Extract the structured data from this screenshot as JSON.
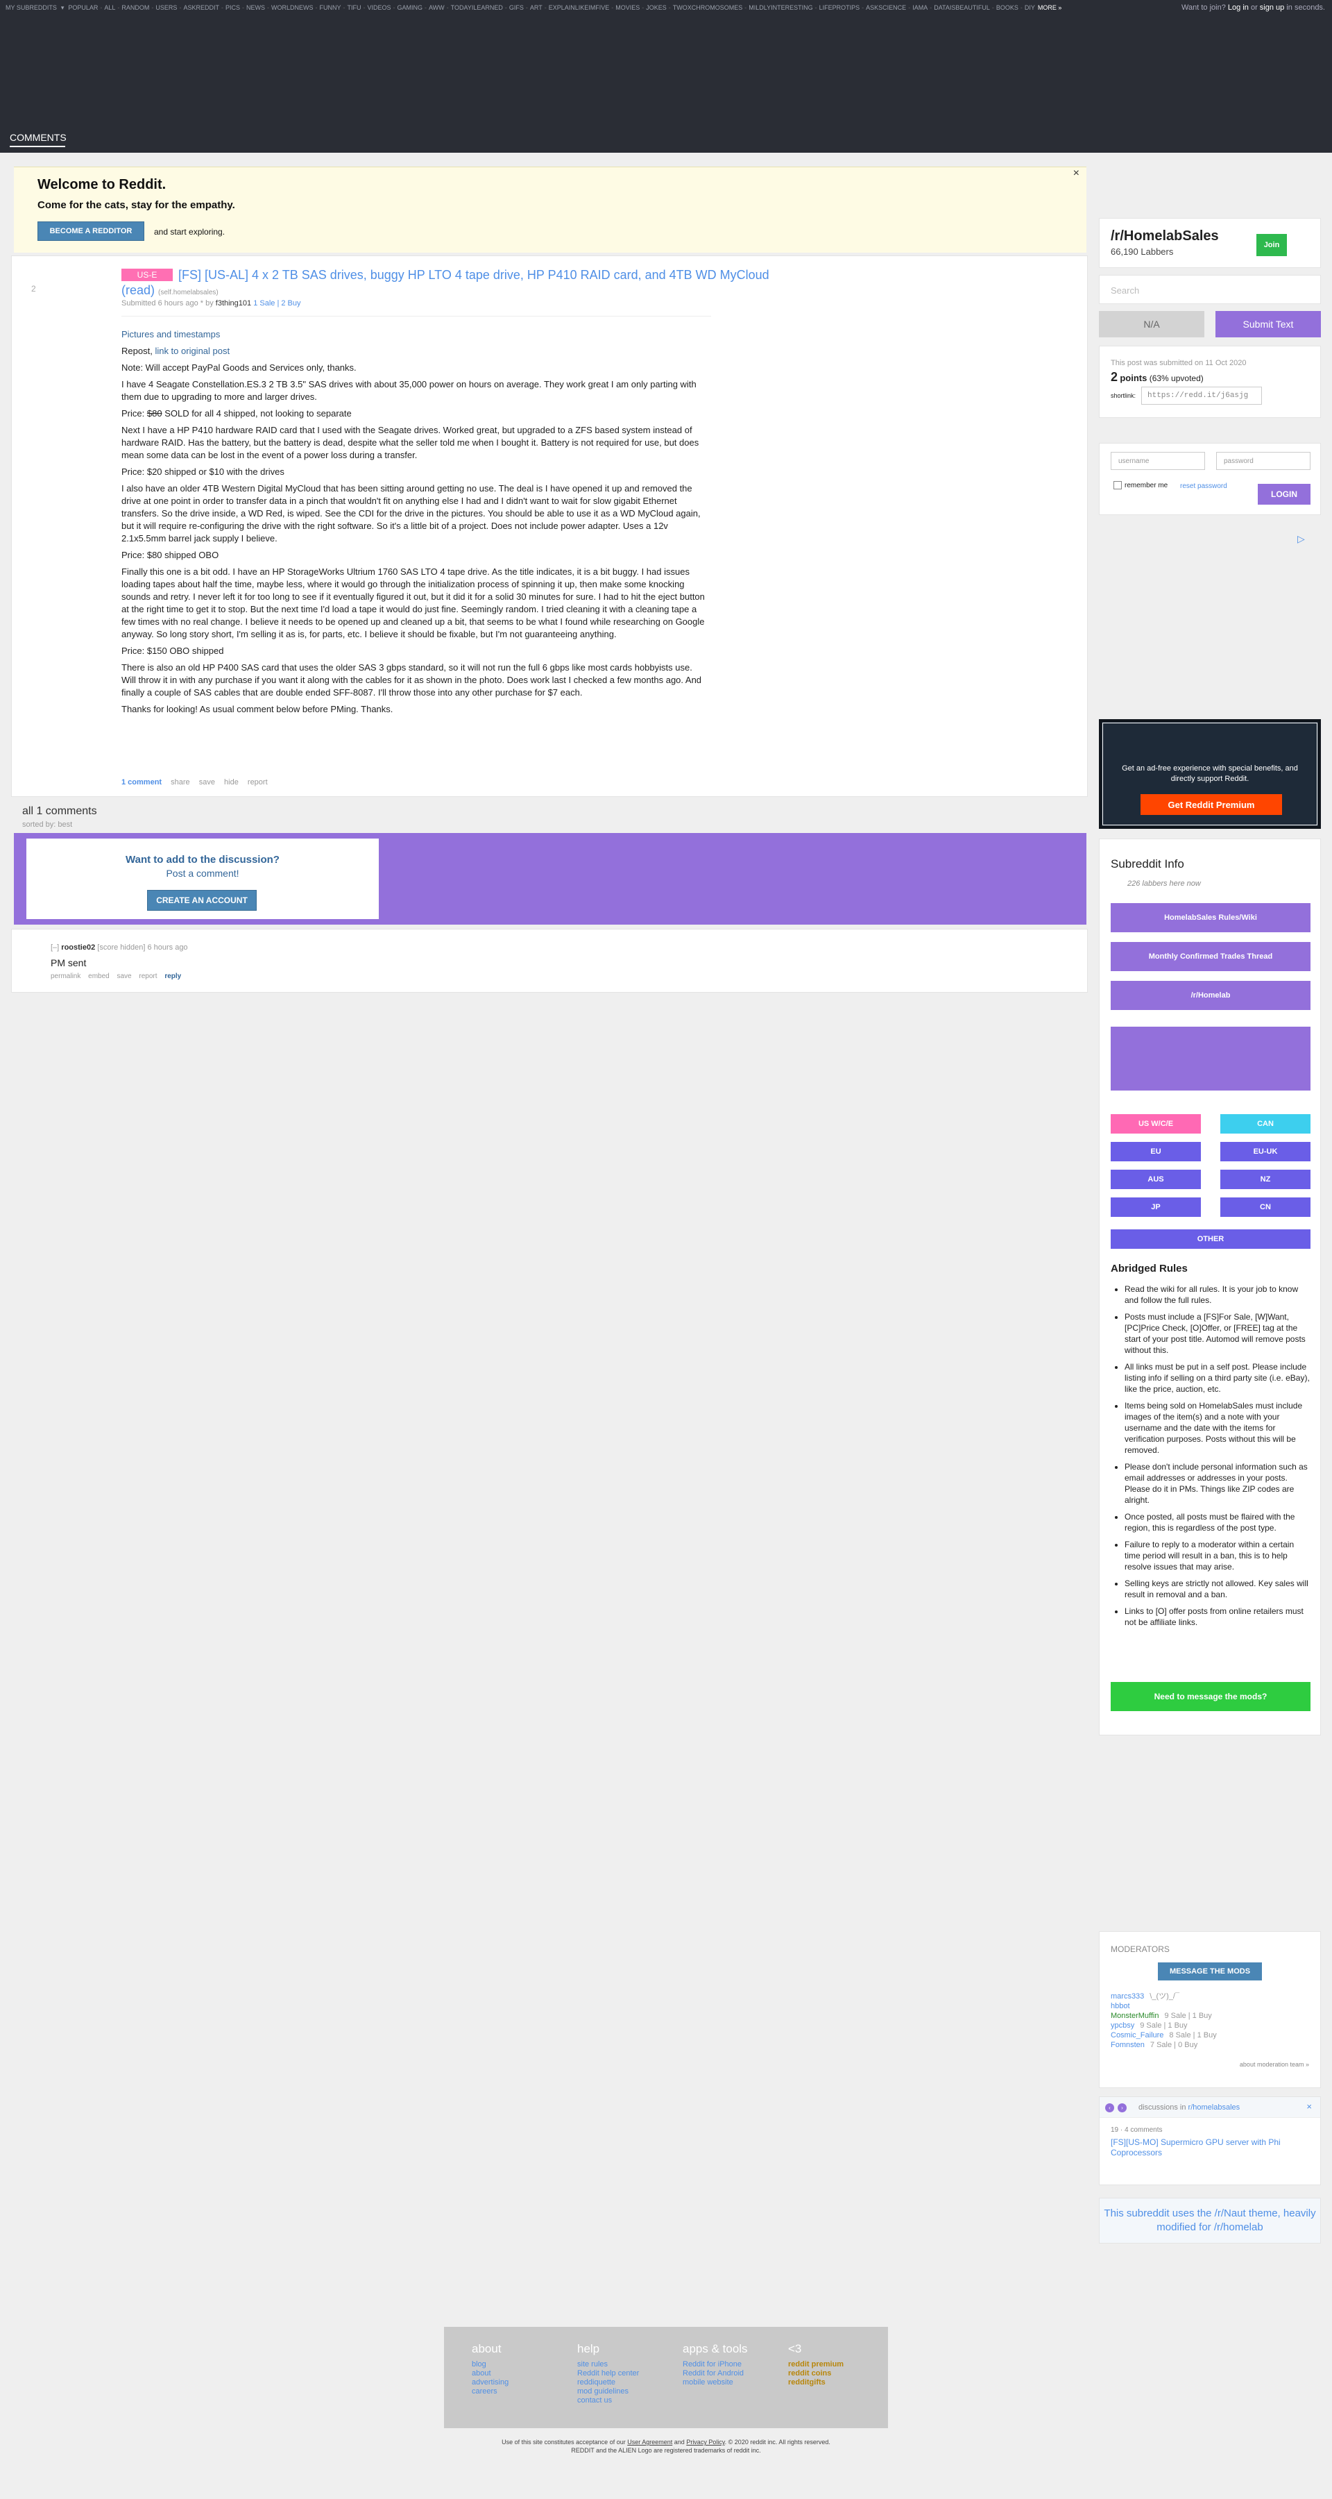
{
  "topbar": {
    "my_subreddits": "MY SUBREDDITS",
    "links": [
      "POPULAR",
      "ALL",
      "RANDOM",
      "USERS",
      "ASKREDDIT",
      "PICS",
      "NEWS",
      "WORLDNEWS",
      "FUNNY",
      "TIFU",
      "VIDEOS",
      "GAMING",
      "AWW",
      "TODAYILEARNED",
      "GIFS",
      "ART",
      "EXPLAINLIKEIMFIVE",
      "MOVIES",
      "JOKES",
      "TWOXCHROMOSOMES",
      "MILDLYINTERESTING",
      "LIFEPROTIPS",
      "ASKSCIENCE",
      "IAMA",
      "DATAISBEAUTIFUL",
      "BOOKS",
      "DIY"
    ],
    "more": "MORE »",
    "right_prefix": "Want to join?",
    "login": "Log in",
    "or": "or",
    "signup": "sign up",
    "right_suffix": "in seconds."
  },
  "header": {
    "tab": "COMMENTS"
  },
  "welcome": {
    "title": "Welcome to Reddit.",
    "subtitle": "Come for the cats, stay for the empathy.",
    "button": "BECOME A REDDITOR",
    "after": "and start exploring.",
    "close": "×"
  },
  "post": {
    "rank": "2",
    "flair": "US-E",
    "title": "[FS] [US-AL] 4 x 2 TB SAS drives, buggy HP LTO 4 tape drive, HP P410 RAID card, and 4TB WD MyCloud (read)",
    "domain": "(self.homelabsales)",
    "submitted": "Submitted 6 hours ago * by",
    "author": "f3thing101",
    "author_flair": "1 Sale | 2 Buy",
    "body": {
      "pictures": "Pictures and timestamps",
      "repost_prefix": "Repost,",
      "repost_link": "link to original post",
      "p_paypal": "Note: Will accept PayPal Goods and Services only, thanks.",
      "p_seagate": "I have 4 Seagate Constellation.ES.3 2 TB 3.5\" SAS drives with about 35,000 power on hours on average. They work great I am only parting with them due to upgrading to more and larger drives.",
      "price1_prefix": "Price:",
      "price1_strike": "$80",
      "price1_rest": "SOLD for all 4 shipped, not looking to separate",
      "p_raid": "Next I have a HP P410 hardware RAID card that I used with the Seagate drives. Worked great, but upgraded to a ZFS based system instead of hardware RAID. Has the battery, but the battery is dead, despite what the seller told me when I bought it. Battery is not required for use, but does mean some data can be lost in the event of a power loss during a transfer.",
      "price2": "Price: $20 shipped or $10 with the drives",
      "p_mycloud": "I also have an older 4TB Western Digital MyCloud that has been sitting around getting no use. The deal is I have opened it up and removed the drive at one point in order to transfer data in a pinch that wouldn't fit on anything else I had and I didn't want to wait for slow gigabit Ethernet transfers. So the drive inside, a WD Red, is wiped. See the CDI for the drive in the pictures. You should be able to use it as a WD MyCloud again, but it will require re-configuring the drive with the right software. So it's a little bit of a project. Does not include power adapter. Uses a 12v 2.1x5.5mm barrel jack supply I believe.",
      "price3": "Price: $80 shipped OBO",
      "p_lto": "Finally this one is a bit odd. I have an HP StorageWorks Ultrium 1760 SAS LTO 4 tape drive. As the title indicates, it is a bit buggy. I had issues loading tapes about half the time, maybe less, where it would go through the initialization process of spinning it up, then make some knocking sounds and retry. I never left it for too long to see if it eventually figured it out, but it did it for a solid 30 minutes for sure. I had to hit the eject button at the right time to get it to stop. But the next time I'd load a tape it would do just fine. Seemingly random. I tried cleaning it with a cleaning tape a few times with no real change. I believe it needs to be opened up and cleaned up a bit, that seems to be what I found while researching on Google anyway. So long story short, I'm selling it as is, for parts, etc. I believe it should be fixable, but I'm not guaranteeing anything.",
      "price4": "Price: $150 OBO shipped",
      "p_p400": "There is also an old HP P400 SAS card that uses the older SAS 3 gbps standard, so it will not run the full 6 gbps like most cards hobbyists use. Will throw it in with any purchase if you want it along with the cables for it as shown in the photo. Does work last I checked a few months ago. And finally a couple of SAS cables that are double ended SFF-8087. I'll throw those into any other purchase for $7 each.",
      "p_thanks": "Thanks for looking! As usual comment below before PMing. Thanks."
    },
    "actions": {
      "comments": "1 comment",
      "share": "share",
      "save": "save",
      "hide": "hide",
      "report": "report"
    }
  },
  "comments_area": {
    "heading": "all 1 comments",
    "sorted": "sorted by: best",
    "want": "Want to add to the discussion?",
    "post_comment": "Post a comment!",
    "create": "CREATE AN ACCOUNT",
    "comment": {
      "collapse": "[–]",
      "author": "roostie02",
      "score": "[score hidden]",
      "time": "6 hours ago",
      "text": "PM sent",
      "actions": [
        "permalink",
        "embed",
        "save",
        "report"
      ],
      "reply": "reply"
    }
  },
  "sidebar": {
    "sub_name": "/r/HomelabSales",
    "labbers": "66,190 Labbers",
    "join": "Join",
    "search_placeholder": "Search",
    "na": "N/A",
    "submit_text": "Submit Text",
    "submitted_on": "This post was submitted on 11 Oct 2020",
    "points": "2",
    "points_label": "points",
    "upvoted": "(63% upvoted)",
    "shortlink_label": "shortlink:",
    "shortlink": "https://redd.it/j6asjg",
    "username_ph": "username",
    "password_ph": "password",
    "remember": "remember me",
    "reset": "reset password",
    "login": "LOGIN",
    "adchoice": "▷",
    "premium_text": "Get an ad-free experience with special benefits, and directly support Reddit.",
    "premium_button": "Get Reddit Premium",
    "info_title": "Subreddit Info",
    "labbers_here": "226 labbers here now",
    "buttons": [
      "HomelabSales Rules/Wiki",
      "Monthly Confirmed Trades Thread",
      "/r/Homelab"
    ],
    "regions": [
      {
        "label": "US W/C/E",
        "color": "#ff69b4"
      },
      {
        "label": "CAN",
        "color": "#3dcfee"
      },
      {
        "label": "EU",
        "color": "#6a5ee7"
      },
      {
        "label": "EU-UK",
        "color": "#6a5ee7"
      },
      {
        "label": "AUS",
        "color": "#6a5ee7"
      },
      {
        "label": "NZ",
        "color": "#6a5ee7"
      },
      {
        "label": "JP",
        "color": "#6a5ee7"
      },
      {
        "label": "CN",
        "color": "#6a5ee7"
      },
      {
        "label": "OTHER",
        "color": "#6a5ee7"
      }
    ],
    "rules_title": "Abridged Rules",
    "rules": [
      "Read the wiki for all rules. It is your job to know and follow the full rules.",
      "Posts must include a [FS]For Sale, [W]Want, [PC]Price Check, [O]Offer, or [FREE] tag at the start of your post title. Automod will remove posts without this.",
      "All links must be put in a self post. Please include listing info if selling on a third party site (i.e. eBay), like the price, auction, etc.",
      "Items being sold on HomelabSales must include images of the item(s) and a note with your username and the date with the items for verification purposes. Posts without this will be removed.",
      "Please don't include personal information such as email addresses or addresses in your posts. Please do it in PMs. Things like ZIP codes are alright.",
      "Once posted, all posts must be flaired with the region, this is regardless of the post type.",
      "Failure to reply to a moderator within a certain time period will result in a ban, this is to help resolve issues that may arise.",
      "Selling keys are strictly not allowed. Key sales will result in removal and a ban.",
      "Links to [O] offer posts from online retailers must not be affiliate links."
    ],
    "modmsg_button": "Need to message the mods?",
    "moderators_title": "MODERATORS",
    "message_mods": "MESSAGE THE MODS",
    "mods": [
      {
        "name": "marcs333",
        "flair": "\\_(ツ)_/¯",
        "green": false
      },
      {
        "name": "hbbot",
        "flair": "",
        "green": false
      },
      {
        "name": "MonsterMuffin",
        "flair": "9 Sale | 1 Buy",
        "green": true
      },
      {
        "name": "ypcbsy",
        "flair": "9 Sale | 1 Buy",
        "green": false
      },
      {
        "name": "Cosmic_Failure",
        "flair": "8 Sale | 1 Buy",
        "green": false
      },
      {
        "name": "Fomnsten",
        "flair": "7 Sale | 0 Buy",
        "green": false
      }
    ],
    "mod_team": "about moderation team »",
    "discussions_prefix": "discussions in",
    "discussions_sub": "r/homelabsales",
    "discussion_meta": "19 · 4 comments",
    "discussion_link": "[FS][US-MO] Supermicro GPU server with Phi Coprocessors",
    "theme_text": "This subreddit uses the /r/Naut theme, heavily modified for /r/homelab"
  },
  "footer": {
    "cols": [
      {
        "title": "about",
        "items": [
          "blog",
          "about",
          "advertising",
          "careers"
        ],
        "orange": false
      },
      {
        "title": "help",
        "items": [
          "site rules",
          "Reddit help center",
          "reddiquette",
          "mod guidelines",
          "contact us"
        ],
        "orange": false
      },
      {
        "title": "apps & tools",
        "items": [
          "Reddit for iPhone",
          "Reddit for Android",
          "mobile website"
        ],
        "orange": false
      },
      {
        "title": "<3",
        "items": [
          "reddit premium",
          "reddit coins",
          "redditgifts"
        ],
        "orange": true
      }
    ],
    "legal_line1_a": "Use of this site constitutes acceptance of our",
    "legal_ua": "User Agreement",
    "legal_and": "and",
    "legal_pp": "Privacy Policy",
    "legal_line1_b": ". © 2020 reddit inc. All rights reserved.",
    "legal_line2": "REDDIT and the ALIEN Logo are registered trademarks of reddit inc."
  }
}
